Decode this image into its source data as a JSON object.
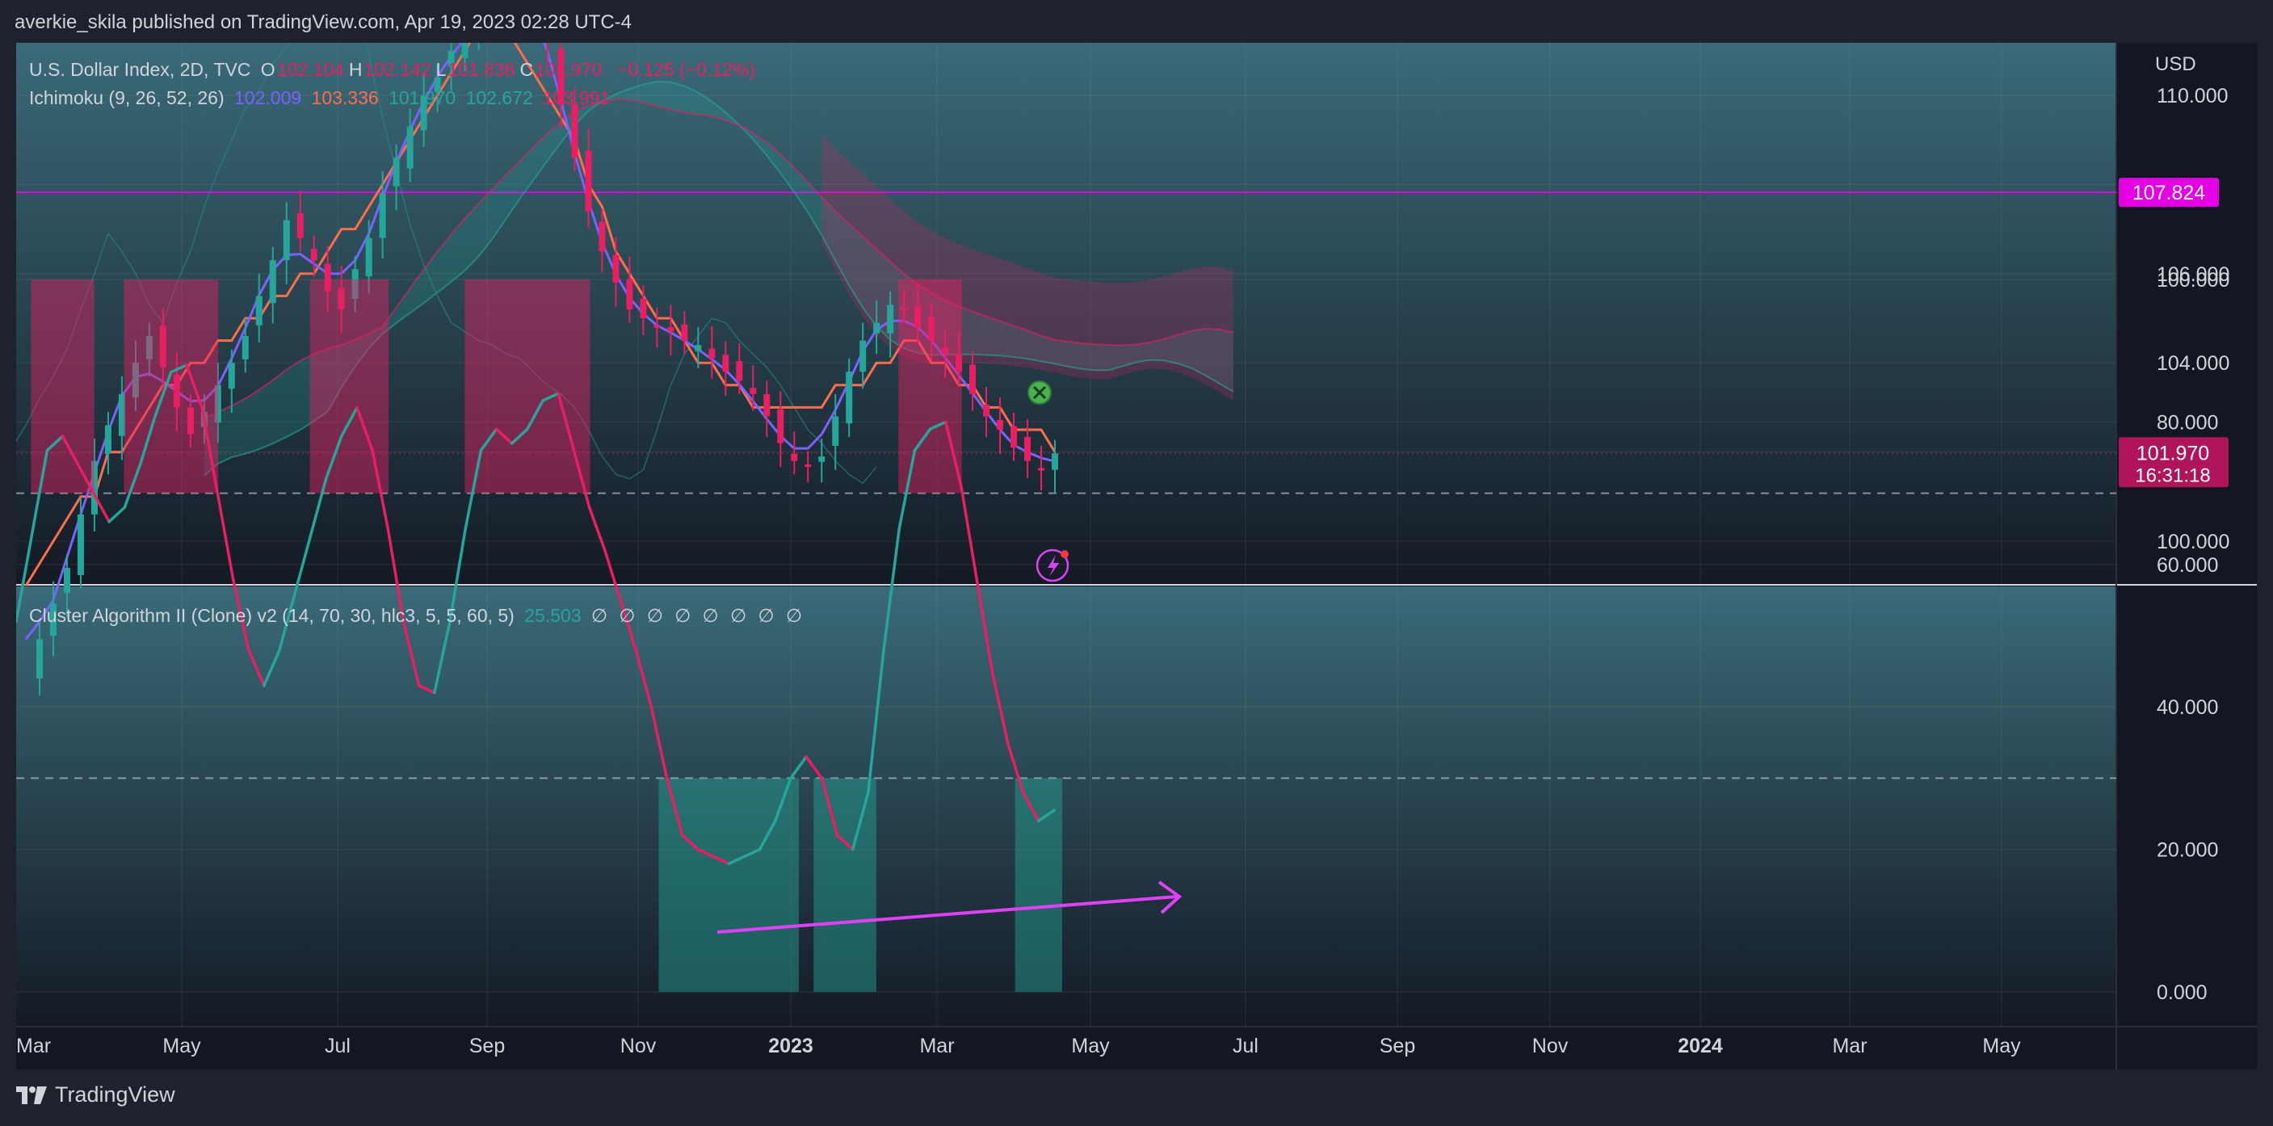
{
  "header": {
    "publisher_line": "averkie_skila published on TradingView.com, Apr 19, 2023 02:28 UTC-4"
  },
  "footer": {
    "brand": "TradingView"
  },
  "main_pane": {
    "symbol_line": "U.S. Dollar Index, 2D, TVC",
    "ohlc": [
      {
        "k": "O",
        "v": "102.104"
      },
      {
        "k": "H",
        "v": "102.142"
      },
      {
        "k": "L",
        "v": "101.838"
      },
      {
        "k": "C",
        "v": "101.970"
      }
    ],
    "change": "−0.125 (−0.12%)",
    "ichimoku_label": "Ichimoku (9, 26, 52, 26)",
    "ichimoku_values": [
      "102.009",
      "103.336",
      "101.970",
      "102.672",
      "103.991"
    ],
    "currency": "USD",
    "horizontal_line_label": "107.824",
    "price_label": "101.970",
    "countdown_label": "16:31:18"
  },
  "indicator_pane": {
    "label": "Cluster Algorithm II (Clone) v2 (14, 70, 30, hlc3, 5, 5, 60, 5)",
    "value": "25.503",
    "empty_marks": [
      "∅",
      "∅",
      "∅",
      "∅",
      "∅",
      "∅",
      "∅",
      "∅"
    ]
  },
  "colors": {
    "bg": "#131722",
    "bull": "#26a69a",
    "bear": "#e91e63",
    "tenkan": "#7b61ff",
    "kijun": "#ff6d4a",
    "chikou": "#2a8a8a",
    "magenta": "#e040fb",
    "hline": "#e600e6"
  },
  "chart_data": [
    {
      "type": "line",
      "title": "U.S. Dollar Index, 2D, TVC",
      "ylabel": "USD",
      "x_ticks": [
        "Mar",
        "May",
        "Jul",
        "Sep",
        "Nov",
        "2023",
        "Mar",
        "May",
        "Jul",
        "Sep",
        "Nov",
        "2024",
        "Mar",
        "May"
      ],
      "y_ticks": [
        "110.000",
        "106.000",
        "104.000",
        "100.000"
      ],
      "ylim": [
        98.5,
        111.5
      ],
      "horizontal_line": 107.824,
      "last_price": 101.97,
      "series": [
        {
          "values": [
            97.0,
            97.8,
            98.6,
            99.4,
            100.6,
            101.8,
            102.6,
            103.3,
            104.0,
            104.6,
            103.9,
            103.0,
            102.4,
            102.9,
            103.5,
            104.0,
            104.6,
            105.5,
            106.3,
            107.2,
            106.8,
            106.3,
            105.6,
            105.2,
            106.1,
            106.8,
            107.8,
            108.6,
            109.3,
            110.0,
            110.4,
            111.0,
            111.4,
            111.6,
            112.0,
            112.5,
            113.0,
            112.4,
            111.2,
            109.8,
            108.6,
            107.4,
            106.5,
            105.8,
            105.2,
            105.0,
            104.8,
            104.7,
            104.5,
            104.4,
            104.1,
            103.8,
            103.6,
            103.3,
            102.8,
            102.2,
            101.8,
            101.7,
            101.9,
            102.8,
            103.8,
            104.5,
            104.9,
            105.3,
            105.2,
            104.8,
            104.5,
            104.2,
            103.8,
            103.3,
            102.8,
            102.5,
            102.1,
            101.8,
            101.6,
            101.97
          ]
        }
      ]
    },
    {
      "type": "line",
      "title": "Cluster Algorithm II (Clone) v2 (14, 70, 30, hlc3, 5, 5, 60, 5)",
      "y_ticks": [
        "100.000",
        "80.000",
        "60.000",
        "40.000",
        "20.000",
        "0.000"
      ],
      "ylim": [
        -10,
        110
      ],
      "thresholds": [
        70,
        30
      ],
      "last_value": 25.503,
      "series": [
        {
          "values": [
            52,
            64,
            76,
            78,
            74,
            70,
            66,
            68,
            74,
            81,
            87,
            88,
            82,
            70,
            58,
            48,
            43,
            48,
            56,
            64,
            72,
            78,
            82,
            76,
            65,
            52,
            43,
            42,
            52,
            65,
            76,
            79,
            77,
            79,
            83,
            84,
            76,
            68,
            62,
            55,
            48,
            40,
            30,
            22,
            20,
            19,
            18,
            19,
            20,
            24,
            30,
            33,
            30,
            22,
            20,
            28,
            48,
            65,
            76,
            79,
            80,
            71,
            58,
            45,
            35,
            28,
            24,
            25.5
          ]
        }
      ]
    }
  ]
}
